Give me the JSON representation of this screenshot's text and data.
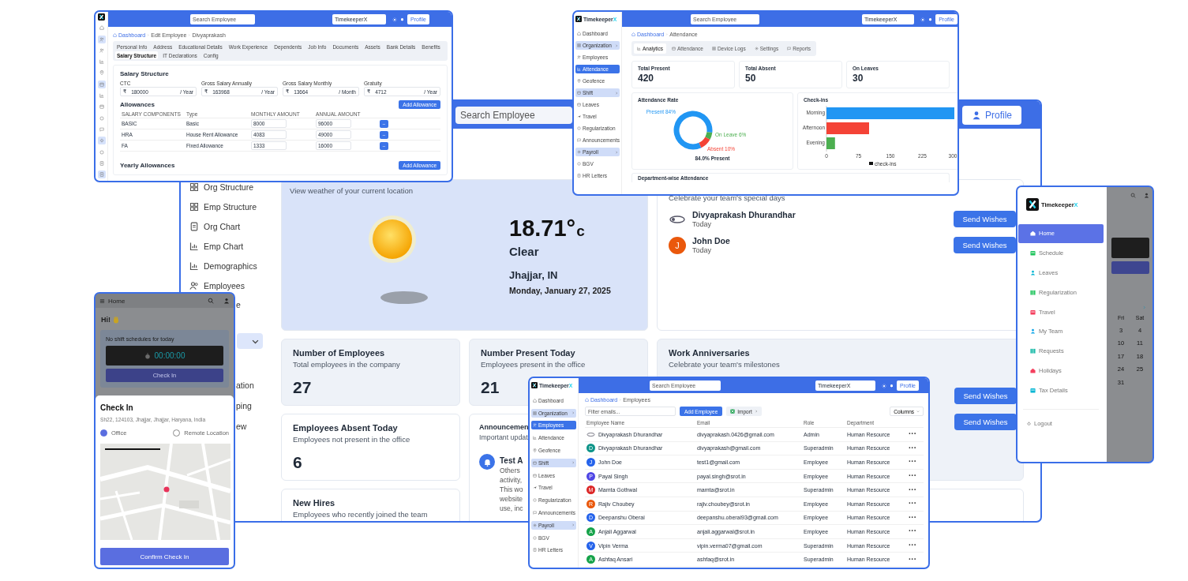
{
  "main_window": {
    "search": {
      "placeholder": "Search Employee"
    },
    "profile_button": "Profile",
    "sidebar": [
      {
        "label": "Org Structure"
      },
      {
        "label": "Emp Structure"
      },
      {
        "label": "Org Chart"
      },
      {
        "label": "Emp Chart"
      },
      {
        "label": "Demographics"
      },
      {
        "label": "Employees"
      }
    ],
    "sidebar_tail": {
      "above": [
        "e"
      ],
      "group": {
        "expanded": true
      },
      "below": [
        "ation",
        "ping",
        "ew"
      ]
    },
    "weather": {
      "caption": "View weather of your current location",
      "temperature": "18.71°",
      "unit": "c",
      "condition": "Clear",
      "location": "Jhajjar, IN",
      "date": "Monday, January 27, 2025"
    },
    "birthdays": {
      "subtitle": "Celebrate your team's special days",
      "people": [
        {
          "kind": "logo",
          "name": "Divyaprakash Dhurandhar",
          "when": "Today",
          "button": "Send Wishes"
        },
        {
          "kind": "initial",
          "initial": "J",
          "color": "#ea580c",
          "name": "John Doe",
          "when": "Today",
          "button": "Send Wishes"
        }
      ]
    },
    "stats": [
      {
        "title": "Number of Employees",
        "subtitle": "Total employees in the company",
        "value": "27"
      },
      {
        "title": "Number Present Today",
        "subtitle": "Employees present in the office",
        "value": "21"
      },
      {
        "title": "Employees Absent Today",
        "subtitle": "Employees not present in the office",
        "value": "6"
      }
    ],
    "anniversaries": {
      "title": "Work Anniversaries",
      "subtitle": "Celebrate your team's milestones",
      "buttons": [
        "Send Wishes",
        "Send Wishes"
      ]
    },
    "announcements": {
      "title": "Announcemen",
      "subtitle": "Important updat",
      "item_title": "Test A",
      "item_lines": [
        "Others",
        "activity,",
        "This wo",
        "website",
        "use, inc"
      ]
    },
    "new_hires": {
      "title": "New Hires",
      "subtitle": "Employees who recently joined the team"
    }
  },
  "salary_window": {
    "search": {
      "placeholder": "Search Employee"
    },
    "company_select": "TimekeeperX",
    "profile_button": "Profile",
    "rail": [
      {
        "selected": false
      },
      {
        "selected": true
      },
      {
        "selected": false
      },
      {
        "selected": false
      },
      {
        "selected": false
      },
      {
        "selected": true
      },
      {
        "selected": false
      },
      {
        "selected": false
      },
      {
        "selected": false
      },
      {
        "selected": false
      },
      {
        "selected": true
      },
      {
        "selected": false
      },
      {
        "selected": false
      },
      {
        "selected": true
      }
    ],
    "breadcrumb": [
      "Dashboard",
      "Edit Employee",
      "Divyaprakash"
    ],
    "tabs": [
      {
        "label": "Personal Info",
        "selected": false
      },
      {
        "label": "Address",
        "selected": false
      },
      {
        "label": "Educational Details",
        "selected": false
      },
      {
        "label": "Work Experience",
        "selected": false
      },
      {
        "label": "Dependents",
        "selected": false
      },
      {
        "label": "Job Info",
        "selected": false
      },
      {
        "label": "Documents",
        "selected": false
      },
      {
        "label": "Assets",
        "selected": false
      },
      {
        "label": "Bank Details",
        "selected": false
      },
      {
        "label": "Benefits",
        "selected": false
      },
      {
        "label": "Salary Structure",
        "selected": true
      },
      {
        "label": "IT Declarations",
        "selected": false
      },
      {
        "label": "Config",
        "selected": false
      }
    ],
    "section_title": "Salary Structure",
    "fields": [
      {
        "label": "CTC",
        "currency": "₹",
        "value": "180000",
        "suffix": "/ Year"
      },
      {
        "label": "Gross Salary Annually",
        "currency": "₹",
        "value": "163968",
        "suffix": "/ Year"
      },
      {
        "label": "Gross Salary Monthly",
        "currency": "₹",
        "value": "13664",
        "suffix": "/ Month"
      },
      {
        "label": "Gratuity",
        "currency": "₹",
        "value": "4712",
        "suffix": "/ Year"
      }
    ],
    "allowances_title": "Allowances",
    "add_button": "Add Allowance",
    "columns": [
      "SALARY COMPONENTS",
      "Type",
      "MONTHLY AMOUNT",
      "ANNUAL AMOUNT"
    ],
    "rows": [
      {
        "component": "BASIC",
        "type": "Basic",
        "monthly": "8000",
        "annual": "96000",
        "remove": "–"
      },
      {
        "component": "HRA",
        "type": "House Rent Allowance",
        "monthly": "4083",
        "annual": "49000",
        "remove": "–"
      },
      {
        "component": "FA",
        "type": "Fixed Allowance",
        "monthly": "1333",
        "annual": "16000",
        "remove": "–"
      }
    ],
    "yearly_title": "Yearly Allowances",
    "yearly_add_button": "Add Allowance"
  },
  "attendance_window": {
    "brand": "TimekeeperX",
    "search": {
      "placeholder": "Search Employee"
    },
    "company_select": "TimekeeperX",
    "profile_button": "Profile",
    "sidebar": [
      {
        "label": "Dashboard",
        "kind": "link",
        "selected": false
      },
      {
        "label": "Organization",
        "kind": "group",
        "selected": false
      },
      {
        "label": "Employees",
        "kind": "link",
        "selected": false
      },
      {
        "label": "Attendance",
        "kind": "link",
        "selected": true
      },
      {
        "label": "Geofence",
        "kind": "link",
        "selected": false
      },
      {
        "label": "Shift",
        "kind": "group",
        "selected": false
      },
      {
        "label": "Leaves",
        "kind": "link",
        "selected": false
      },
      {
        "label": "Travel",
        "kind": "link",
        "selected": false
      },
      {
        "label": "Regularization",
        "kind": "link",
        "selected": false
      },
      {
        "label": "Announcements",
        "kind": "link",
        "selected": false
      },
      {
        "label": "Payroll",
        "kind": "group",
        "selected": false
      },
      {
        "label": "BGV",
        "kind": "link",
        "selected": false
      },
      {
        "label": "HR Letters",
        "kind": "link",
        "selected": false
      }
    ],
    "breadcrumb": [
      "Dashboard",
      "Attendance"
    ],
    "tabs": [
      {
        "label": "Analytics",
        "selected": true
      },
      {
        "label": "Attendance",
        "selected": false
      },
      {
        "label": "Device Logs",
        "selected": false
      },
      {
        "label": "Settings",
        "selected": false
      },
      {
        "label": "Reports",
        "selected": false
      }
    ],
    "stats": [
      {
        "title": "Total Present",
        "value": "420"
      },
      {
        "title": "Total Absent",
        "value": "50"
      },
      {
        "title": "On Leaves",
        "value": "30"
      }
    ],
    "rate_card": {
      "summary": "84.0% Present",
      "chart_data": {
        "type": "donut",
        "title": "Attendance Rate",
        "categories": [
          "Present",
          "On Leave",
          "Absent"
        ],
        "values": [
          84,
          6,
          10
        ],
        "value_labels": [
          "84%",
          "6%",
          "10%"
        ]
      }
    },
    "checkins_card": {
      "chart_data": {
        "type": "bar",
        "orientation": "horizontal",
        "title": "Check-ins",
        "categories": [
          "Morning",
          "Afternoon",
          "Evening"
        ],
        "series": [
          {
            "name": "check-ins",
            "values": [
              300,
              100,
              20
            ]
          }
        ],
        "xlim": [
          0,
          300
        ],
        "xticks": [
          0,
          75,
          150,
          225,
          300
        ]
      }
    },
    "department_title": "Department-wise Attendance"
  },
  "checkin_screen": {
    "title": "Home",
    "greeting": "Hi!",
    "notice": "No shift schedules for today",
    "timer": "00:00:00",
    "check_in_button": "Check In",
    "sheet": {
      "title": "Check In",
      "address": "Sh22, 124103, Jhajjar, Jhajjar, Haryana, India",
      "options": [
        {
          "label": "Office",
          "selected": true
        },
        {
          "label": "Remote Location",
          "selected": false
        }
      ],
      "confirm_button": "Confirm Check In"
    }
  },
  "employees_window": {
    "brand": "TimekeeperX",
    "search": {
      "placeholder": "Search Employee"
    },
    "company_select": "TimekeeperX",
    "profile_button": "Profile",
    "sidebar": [
      {
        "label": "Dashboard",
        "kind": "link",
        "selected": false
      },
      {
        "label": "Organization",
        "kind": "group",
        "selected": false
      },
      {
        "label": "Employees",
        "kind": "link",
        "selected": true
      },
      {
        "label": "Attendance",
        "kind": "link",
        "selected": false
      },
      {
        "label": "Geofence",
        "kind": "link",
        "selected": false
      },
      {
        "label": "Shift",
        "kind": "group",
        "selected": false
      },
      {
        "label": "Leaves",
        "kind": "link",
        "selected": false
      },
      {
        "label": "Travel",
        "kind": "link",
        "selected": false
      },
      {
        "label": "Regularization",
        "kind": "link",
        "selected": false
      },
      {
        "label": "Announcements",
        "kind": "link",
        "selected": false
      },
      {
        "label": "Payroll",
        "kind": "group",
        "selected": false
      },
      {
        "label": "BGV",
        "kind": "link",
        "selected": false
      },
      {
        "label": "HR Letters",
        "kind": "link",
        "selected": false
      }
    ],
    "breadcrumb": [
      "Dashboard",
      "Employees"
    ],
    "filter": {
      "placeholder": "Filter emails..."
    },
    "add_button": "Add Employee",
    "import_button": "Import",
    "columns_button": "Columns",
    "columns": [
      "Employee Name",
      "Email",
      "Role",
      "Department"
    ],
    "rows": [
      {
        "kind": "logo",
        "name": "Divyaprakash Dhurandhar",
        "email": "divyaprakash.0426@gmail.com",
        "role": "Admin",
        "department": "Human Resource",
        "actions": "···"
      },
      {
        "kind": "initial",
        "initial": "D",
        "color": "#0d9488",
        "name": "Divyaprakash Dhurandhar",
        "email": "divyaprakash@gmail.com",
        "role": "Superadmin",
        "department": "Human Resource",
        "actions": "···"
      },
      {
        "kind": "initial",
        "initial": "J",
        "color": "#2563eb",
        "name": "John Doe",
        "email": "test1@gmail.com",
        "role": "Employee",
        "department": "Human Resource",
        "actions": "···"
      },
      {
        "kind": "initial",
        "initial": "P",
        "color": "#4f46e5",
        "name": "Payal Singh",
        "email": "payal.singh@srot.in",
        "role": "Employee",
        "department": "Human Resource",
        "actions": "···"
      },
      {
        "kind": "initial",
        "initial": "M",
        "color": "#dc2626",
        "name": "Mamta Gothwal",
        "email": "mamta@srot.in",
        "role": "Superadmin",
        "department": "Human Resource",
        "actions": "···"
      },
      {
        "kind": "initial",
        "initial": "R",
        "color": "#ea580c",
        "name": "Rajiv Choubey",
        "email": "rajiv.choubey@srot.in",
        "role": "Employee",
        "department": "Human Resource",
        "actions": "···"
      },
      {
        "kind": "initial",
        "initial": "D",
        "color": "#2563eb",
        "name": "Deepanshu Oberai",
        "email": "deepanshu.oberai93@gmail.com",
        "role": "Employee",
        "department": "Human Resource",
        "actions": "···"
      },
      {
        "kind": "initial",
        "initial": "A",
        "color": "#16a34a",
        "name": "Anjali Aggarwal",
        "email": "anjali.aggarwal@srot.in",
        "role": "Employee",
        "department": "Human Resource",
        "actions": "···"
      },
      {
        "kind": "initial",
        "initial": "V",
        "color": "#2563eb",
        "name": "Vipin Verma",
        "email": "vipin.verma07@gmail.com",
        "role": "Superadmin",
        "department": "Human Resource",
        "actions": "···"
      },
      {
        "kind": "initial",
        "initial": "A",
        "color": "#16a34a",
        "name": "Ashfaq Ansari",
        "email": "ashfaq@srot.in",
        "role": "Superadmin",
        "department": "Human Resource",
        "actions": "···"
      }
    ]
  },
  "menu_drawer": {
    "brand": "TimekeeperX",
    "items": [
      {
        "label": "Home",
        "selected": true,
        "color": "#ffffff"
      },
      {
        "label": "Schedule",
        "selected": false,
        "color": "#22c55e"
      },
      {
        "label": "Leaves",
        "selected": false,
        "color": "#06b6d4"
      },
      {
        "label": "Regularization",
        "selected": false,
        "color": "#22c55e"
      },
      {
        "label": "Travel",
        "selected": false,
        "color": "#f43f5e"
      },
      {
        "label": "My Team",
        "selected": false,
        "color": "#0ea5e9"
      },
      {
        "label": "Requests",
        "selected": false,
        "color": "#14b8a6"
      },
      {
        "label": "Holidays",
        "selected": false,
        "color": "#f43f5e"
      },
      {
        "label": "Tax Details",
        "selected": false,
        "color": "#06b6d4"
      }
    ],
    "logout": "Logout",
    "calendar": {
      "weekdays": [
        "Fri",
        "Sat"
      ],
      "weeks": [
        [
          "3",
          "4"
        ],
        [
          "10",
          "11"
        ],
        [
          "17",
          "18"
        ],
        [
          "24",
          "25"
        ],
        [
          "31"
        ]
      ]
    }
  }
}
